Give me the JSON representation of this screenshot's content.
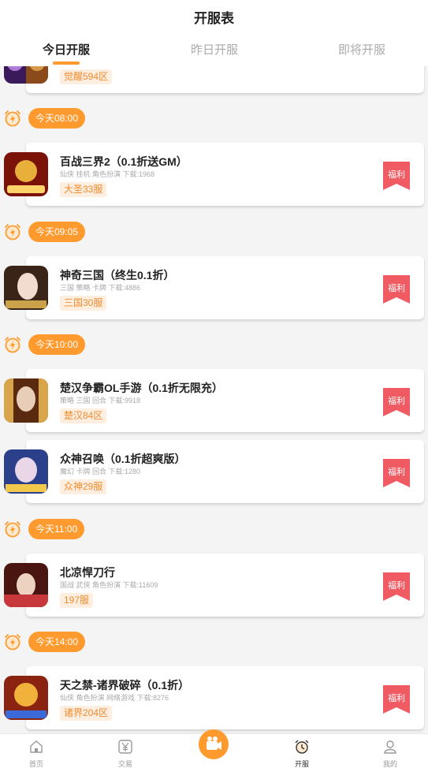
{
  "header": {
    "title": "开服表"
  },
  "tabs": [
    {
      "label": "今日开服",
      "active": true
    },
    {
      "label": "昨日开服",
      "active": false
    },
    {
      "label": "即将开服",
      "active": false
    }
  ],
  "welfare_label": "福利",
  "partial_top_card": {
    "server": "觉醒594区"
  },
  "sections": [
    {
      "time": "今天08:00",
      "games": [
        {
          "name": "百战三界2（0.1折送GM）",
          "tags": "仙侠 挂机 角色扮演",
          "downloads": "下载:1968",
          "server": "大圣33服",
          "icon_colors": [
            "#7a1208",
            "#e8b03a"
          ]
        }
      ]
    },
    {
      "time": "今天09:05",
      "games": [
        {
          "name": "神奇三国（终生0.1折）",
          "tags": "三国 策略 卡牌",
          "downloads": "下载:4886",
          "server": "三国30服",
          "icon_colors": [
            "#3a2418",
            "#f2dccd"
          ]
        }
      ]
    },
    {
      "time": "今天10:00",
      "games": [
        {
          "name": "楚汉争霸OL手游（0.1折无限充）",
          "tags": "策略 三国 回合",
          "downloads": "下载:9918",
          "server": "楚汉84区",
          "icon_colors": [
            "#5a2a10",
            "#d9a54a"
          ]
        },
        {
          "name": "众神召唤（0.1折超爽版）",
          "tags": "魔幻 卡牌 回合",
          "downloads": "下载:1280",
          "server": "众神29服",
          "icon_colors": [
            "#2b3f8a",
            "#e9d6e6"
          ]
        }
      ]
    },
    {
      "time": "今天11:00",
      "games": [
        {
          "name": "北凉悍刀行",
          "tags": "国战 武侠 角色扮演",
          "downloads": "下载:11609",
          "server": "197服",
          "icon_colors": [
            "#4a1410",
            "#c8383a"
          ]
        }
      ]
    },
    {
      "time": "今天14:00",
      "games": [
        {
          "name": "天之禁-诸界破碎（0.1折）",
          "tags": "仙侠 角色扮演 网络游戏",
          "downloads": "下载:8276",
          "server": "诸界204区",
          "icon_colors": [
            "#8a2410",
            "#f0b23a"
          ]
        }
      ]
    }
  ],
  "bottom_nav": [
    {
      "label": "首页",
      "icon": "home-icon"
    },
    {
      "label": "交易",
      "icon": "yen-icon"
    },
    {
      "label": "",
      "icon": "video-icon"
    },
    {
      "label": "开服",
      "icon": "alarm-clock-icon"
    },
    {
      "label": "我的",
      "icon": "user-icon"
    }
  ],
  "colors": {
    "accent": "#ff9a2e",
    "welfare_red": "#f05a62",
    "tag_bg": "#fdeee0",
    "tag_text": "#f08b2e"
  }
}
